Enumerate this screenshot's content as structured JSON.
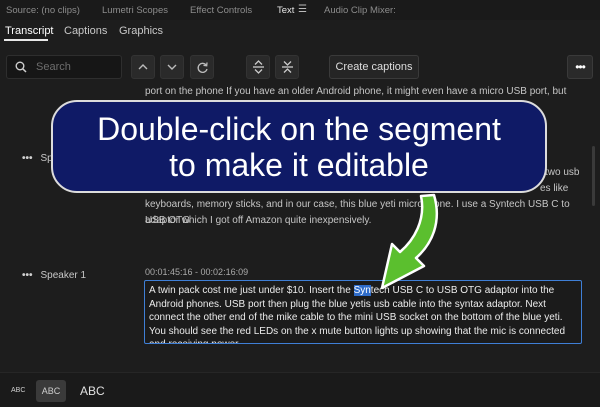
{
  "panel_tabs": [
    {
      "label": "Source: (no clips)"
    },
    {
      "label": "Lumetri Scopes"
    },
    {
      "label": "Effect Controls"
    },
    {
      "label": "Text"
    },
    {
      "label": "Audio Clip Mixer:"
    }
  ],
  "panel_menu_icon": "hamburger-menu-icon",
  "sub_tabs": [
    {
      "label": "Transcript"
    },
    {
      "label": "Captions"
    },
    {
      "label": "Graphics"
    }
  ],
  "toolbar": {
    "search_placeholder": "Search",
    "create_captions_label": "Create captions",
    "more_label": "•••"
  },
  "transcript": {
    "top_text": "port on the phone If you have an older Android phone, it might even have a micro USB port, but you still",
    "segment1": {
      "speaker_partial": "Sp",
      "line_a_fragment": "C two usb",
      "line_b_fragment": "es like",
      "line_c": "keyboards, memory sticks, and in our case, this blue yeti microphone. I use a Syntech USB C to USB OTG",
      "line_d": "adaptor which I got off Amazon quite inexpensively."
    },
    "segment2": {
      "speaker": "Speaker 1",
      "dots": "•••",
      "timestamp": "00:01:45:16 - 00:02:16:09",
      "text_before": "A twin pack cost me just under $10. Insert the ",
      "highlight": "Syn",
      "text_after": "tech USB C to USB OTG adaptor into the Android phones. USB port then plug the blue yetis usb cable into the syntax adaptor. Next connect the other end of the mike cable to the mini USB socket on the bottom of the blue yeti. You should see the red LEDs on the x mute button lights up showing that the mic is connected and receiving power."
    }
  },
  "callout": {
    "line1": "Double-click on the segment",
    "line2": "to make it editable"
  },
  "font_size_options": [
    {
      "label": "ABC"
    },
    {
      "label": "ABC"
    },
    {
      "label": "ABC"
    }
  ],
  "colors": {
    "accent_blue": "#3f7fd6",
    "callout_bg": "#0f1a66",
    "arrow_green": "#5bbf2e"
  }
}
